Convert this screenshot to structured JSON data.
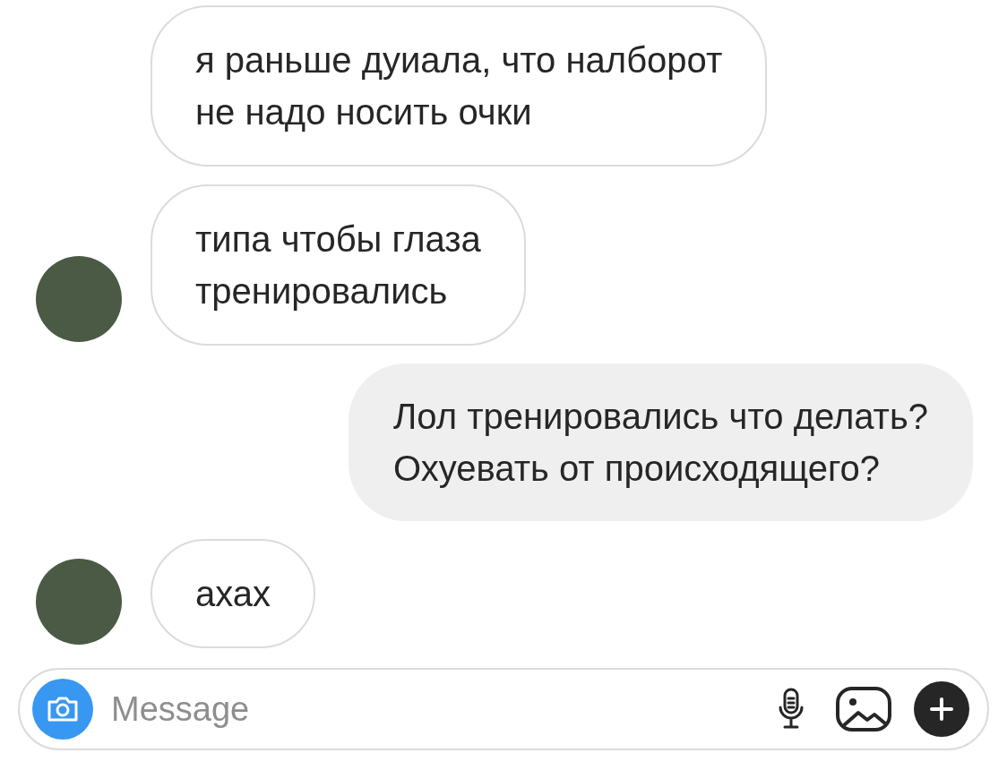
{
  "messages": [
    {
      "kind": "incoming",
      "show_avatar": false,
      "text": "я раньше дуиала, что налборот\nне надо носить очки"
    },
    {
      "kind": "incoming",
      "show_avatar": true,
      "text": "типа чтобы глаза\nтренировались"
    },
    {
      "kind": "outgoing",
      "text": "Лол тренировались что делать?\nОхуевать от происходящего?"
    },
    {
      "kind": "incoming",
      "show_avatar": true,
      "text": "ахах"
    }
  ],
  "composer": {
    "placeholder": "Message"
  }
}
